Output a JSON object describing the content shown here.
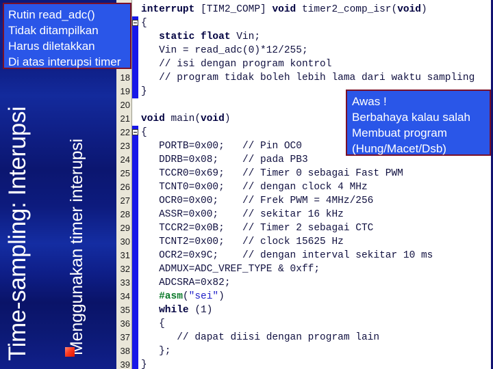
{
  "slide": {
    "title_main": "Time-sampling: Interupsi",
    "title_sub": "Menggunakan timer interupsi",
    "bullet_icon": "red-square-bullet"
  },
  "callout_top": {
    "name": "read-adc-note",
    "lines": [
      "Rutin read_adc()",
      "Tidak ditampilkan",
      "Harus diletakkan",
      "Di atas interupsi timer"
    ]
  },
  "callout_warning": {
    "name": "danger-note",
    "lines": [
      "Awas !",
      "Berbahaya kalau salah",
      "Membuat program",
      "(Hung/Macet/Dsb)"
    ]
  },
  "editor": {
    "gutter_start_line": 18,
    "line_numbers": [
      18,
      19,
      20,
      21,
      22,
      23,
      24,
      25,
      26,
      27,
      28,
      29,
      30,
      31,
      32,
      33,
      34,
      35,
      36,
      37,
      38,
      39
    ],
    "colors": {
      "keyword": "#000040",
      "comment": "#101040",
      "preprocessor": "#0b7a2a",
      "string": "#2020c8",
      "gutter_bg": "#e9e6d8",
      "indent_bar": "#1818e8",
      "callout_bg": "#2a56e8",
      "callout_border": "#7a1028"
    },
    "lines": [
      {
        "n": "",
        "segs": [
          {
            "t": "interrupt",
            "c": "kw"
          },
          {
            "t": " [TIM2_COMP] ",
            "c": "plain"
          },
          {
            "t": "void",
            "c": "kw"
          },
          {
            "t": " timer2_comp_isr(",
            "c": "plain"
          },
          {
            "t": "void",
            "c": "kw"
          },
          {
            "t": ")",
            "c": "plain"
          }
        ]
      },
      {
        "n": "",
        "segs": [
          {
            "t": "{",
            "c": "plain"
          }
        ]
      },
      {
        "n": "",
        "segs": [
          {
            "t": "   ",
            "c": "plain"
          },
          {
            "t": "static float",
            "c": "kw"
          },
          {
            "t": " Vin;",
            "c": "plain"
          }
        ]
      },
      {
        "n": "",
        "segs": [
          {
            "t": "   Vin = read_adc(0)*12/255;",
            "c": "plain"
          }
        ]
      },
      {
        "n": "",
        "segs": [
          {
            "t": "   // isi dengan program kontrol",
            "c": "cmt"
          }
        ]
      },
      {
        "n": "18",
        "segs": [
          {
            "t": "   // program tidak boleh lebih lama dari waktu sampling",
            "c": "cmt"
          }
        ]
      },
      {
        "n": "19",
        "segs": [
          {
            "t": "}",
            "c": "plain"
          }
        ]
      },
      {
        "n": "20",
        "segs": [
          {
            "t": "",
            "c": "plain"
          }
        ]
      },
      {
        "n": "21",
        "segs": [
          {
            "t": "void",
            "c": "kw"
          },
          {
            "t": " main(",
            "c": "plain"
          },
          {
            "t": "void",
            "c": "kw"
          },
          {
            "t": ")",
            "c": "plain"
          }
        ]
      },
      {
        "n": "22",
        "segs": [
          {
            "t": "{",
            "c": "plain"
          }
        ]
      },
      {
        "n": "23",
        "segs": [
          {
            "t": "   PORTB=0x00;   ",
            "c": "plain"
          },
          {
            "t": "// Pin OC0",
            "c": "cmt"
          }
        ]
      },
      {
        "n": "24",
        "segs": [
          {
            "t": "   DDRB=0x08;    ",
            "c": "plain"
          },
          {
            "t": "// pada PB3",
            "c": "cmt"
          }
        ]
      },
      {
        "n": "25",
        "segs": [
          {
            "t": "   TCCR0=0x69;   ",
            "c": "plain"
          },
          {
            "t": "// Timer 0 sebagai Fast PWM",
            "c": "cmt"
          }
        ]
      },
      {
        "n": "26",
        "segs": [
          {
            "t": "   TCNT0=0x00;   ",
            "c": "plain"
          },
          {
            "t": "// dengan clock 4 MHz",
            "c": "cmt"
          }
        ]
      },
      {
        "n": "27",
        "segs": [
          {
            "t": "   OCR0=0x00;    ",
            "c": "plain"
          },
          {
            "t": "// Frek PWM = 4MHz/256",
            "c": "cmt"
          }
        ]
      },
      {
        "n": "28",
        "segs": [
          {
            "t": "   ASSR=0x00;    ",
            "c": "plain"
          },
          {
            "t": "// sekitar 16 kHz",
            "c": "cmt"
          }
        ]
      },
      {
        "n": "29",
        "segs": [
          {
            "t": "   TCCR2=0x0B;   ",
            "c": "plain"
          },
          {
            "t": "// Timer 2 sebagai CTC",
            "c": "cmt"
          }
        ]
      },
      {
        "n": "30",
        "segs": [
          {
            "t": "   TCNT2=0x00;   ",
            "c": "plain"
          },
          {
            "t": "// clock 15625 Hz",
            "c": "cmt"
          }
        ]
      },
      {
        "n": "31",
        "segs": [
          {
            "t": "   OCR2=0x9C;    ",
            "c": "plain"
          },
          {
            "t": "// dengan interval sekitar 10 ms",
            "c": "cmt"
          }
        ]
      },
      {
        "n": "32",
        "segs": [
          {
            "t": "   ADMUX=ADC_VREF_TYPE & 0xff;",
            "c": "plain"
          }
        ]
      },
      {
        "n": "33",
        "segs": [
          {
            "t": "   ADCSRA=0x82;",
            "c": "plain"
          }
        ]
      },
      {
        "n": "34",
        "segs": [
          {
            "t": "   #asm",
            "c": "pre"
          },
          {
            "t": "(",
            "c": "plain"
          },
          {
            "t": "\"sei\"",
            "c": "str"
          },
          {
            "t": ")",
            "c": "plain"
          }
        ]
      },
      {
        "n": "35",
        "segs": [
          {
            "t": "   while",
            "c": "kw"
          },
          {
            "t": " (1)",
            "c": "plain"
          }
        ]
      },
      {
        "n": "36",
        "segs": [
          {
            "t": "   {",
            "c": "plain"
          }
        ]
      },
      {
        "n": "37",
        "segs": [
          {
            "t": "      // dapat diisi dengan program lain",
            "c": "cmt"
          }
        ]
      },
      {
        "n": "38",
        "segs": [
          {
            "t": "   };",
            "c": "plain"
          }
        ]
      },
      {
        "n": "39",
        "segs": [
          {
            "t": "}",
            "c": "plain"
          }
        ]
      }
    ]
  }
}
